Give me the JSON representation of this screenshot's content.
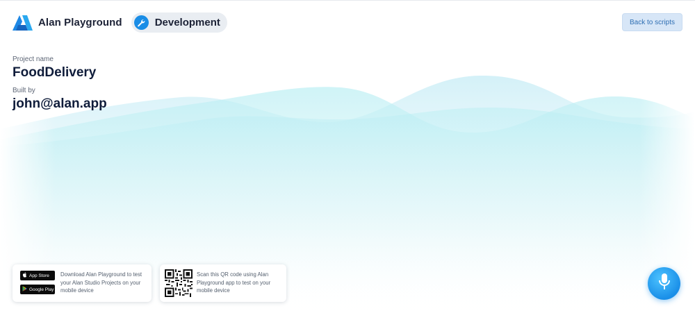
{
  "header": {
    "app_name": "Alan Playground",
    "environment_label": "Development",
    "back_button_label": "Back to scripts"
  },
  "project": {
    "name_label": "Project name",
    "name_value": "FoodDelivery",
    "built_by_label": "Built by",
    "built_by_value": "john@alan.app"
  },
  "footer_cards": {
    "stores": {
      "app_store_badge": "App Store",
      "google_play_badge": "Google Play",
      "text": "Download Alan Playground to test your Alan Studio Projects on your mobile device"
    },
    "qr": {
      "text": "Scan this QR code using Alan Playground app to test on your mobile device"
    }
  },
  "colors": {
    "accent": "#1a8de6",
    "button_bg": "#d7e6f7",
    "button_text": "#2f6fb3",
    "wave": "#b8ecf2"
  },
  "icons": {
    "logo": "alan-logo-icon",
    "environment": "wrench-icon",
    "apple": "apple-icon",
    "google_play": "google-play-icon",
    "qr": "qr-code-icon",
    "mic": "microphone-icon"
  }
}
